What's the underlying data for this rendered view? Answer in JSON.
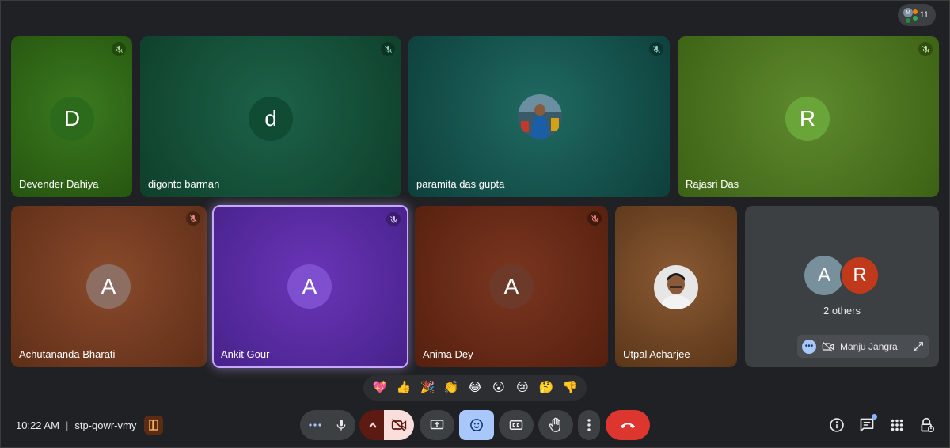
{
  "header": {
    "participant_count": "11",
    "chip_avatar_letter": "M"
  },
  "colors": {
    "background": "#202124",
    "end_call": "#ea4335",
    "active_blue": "#a8c7fa",
    "active_speaker_border": "#c6a9ff"
  },
  "participants": [
    {
      "name": "Devender Dahiya",
      "initial": "D",
      "muted": true
    },
    {
      "name": "digonto barman",
      "initial": "d",
      "muted": true
    },
    {
      "name": "paramita das gupta",
      "initial": "",
      "muted": true,
      "has_photo": true
    },
    {
      "name": "Rajasri Das",
      "initial": "R",
      "muted": true
    },
    {
      "name": "Achutananda Bharati",
      "initial": "A",
      "muted": true
    },
    {
      "name": "Ankit Gour",
      "initial": "A",
      "muted": true,
      "active": true
    },
    {
      "name": "Anima Dey",
      "initial": "A",
      "muted": true
    },
    {
      "name": "Utpal Acharjee",
      "initial": "",
      "muted": false,
      "has_photo": true
    }
  ],
  "others_tile": {
    "avatar_1": "A",
    "avatar_2": "R",
    "label": "2 others",
    "presenter_name": "Manju Jangra"
  },
  "reactions": [
    "💖",
    "👍",
    "🎉",
    "👏",
    "😂",
    "😮",
    "😢",
    "🤔",
    "👎"
  ],
  "footer": {
    "time": "10:22 AM",
    "separator": "|",
    "meeting_code": "stp-qowr-vmy"
  },
  "controls": [
    "more-options",
    "microphone",
    "camera-options",
    "camera-off",
    "present-screen",
    "send-reaction",
    "captions",
    "raise-hand",
    "more-actions",
    "leave-call"
  ],
  "right_controls": [
    "meeting-details",
    "chat",
    "activities",
    "host-controls"
  ]
}
